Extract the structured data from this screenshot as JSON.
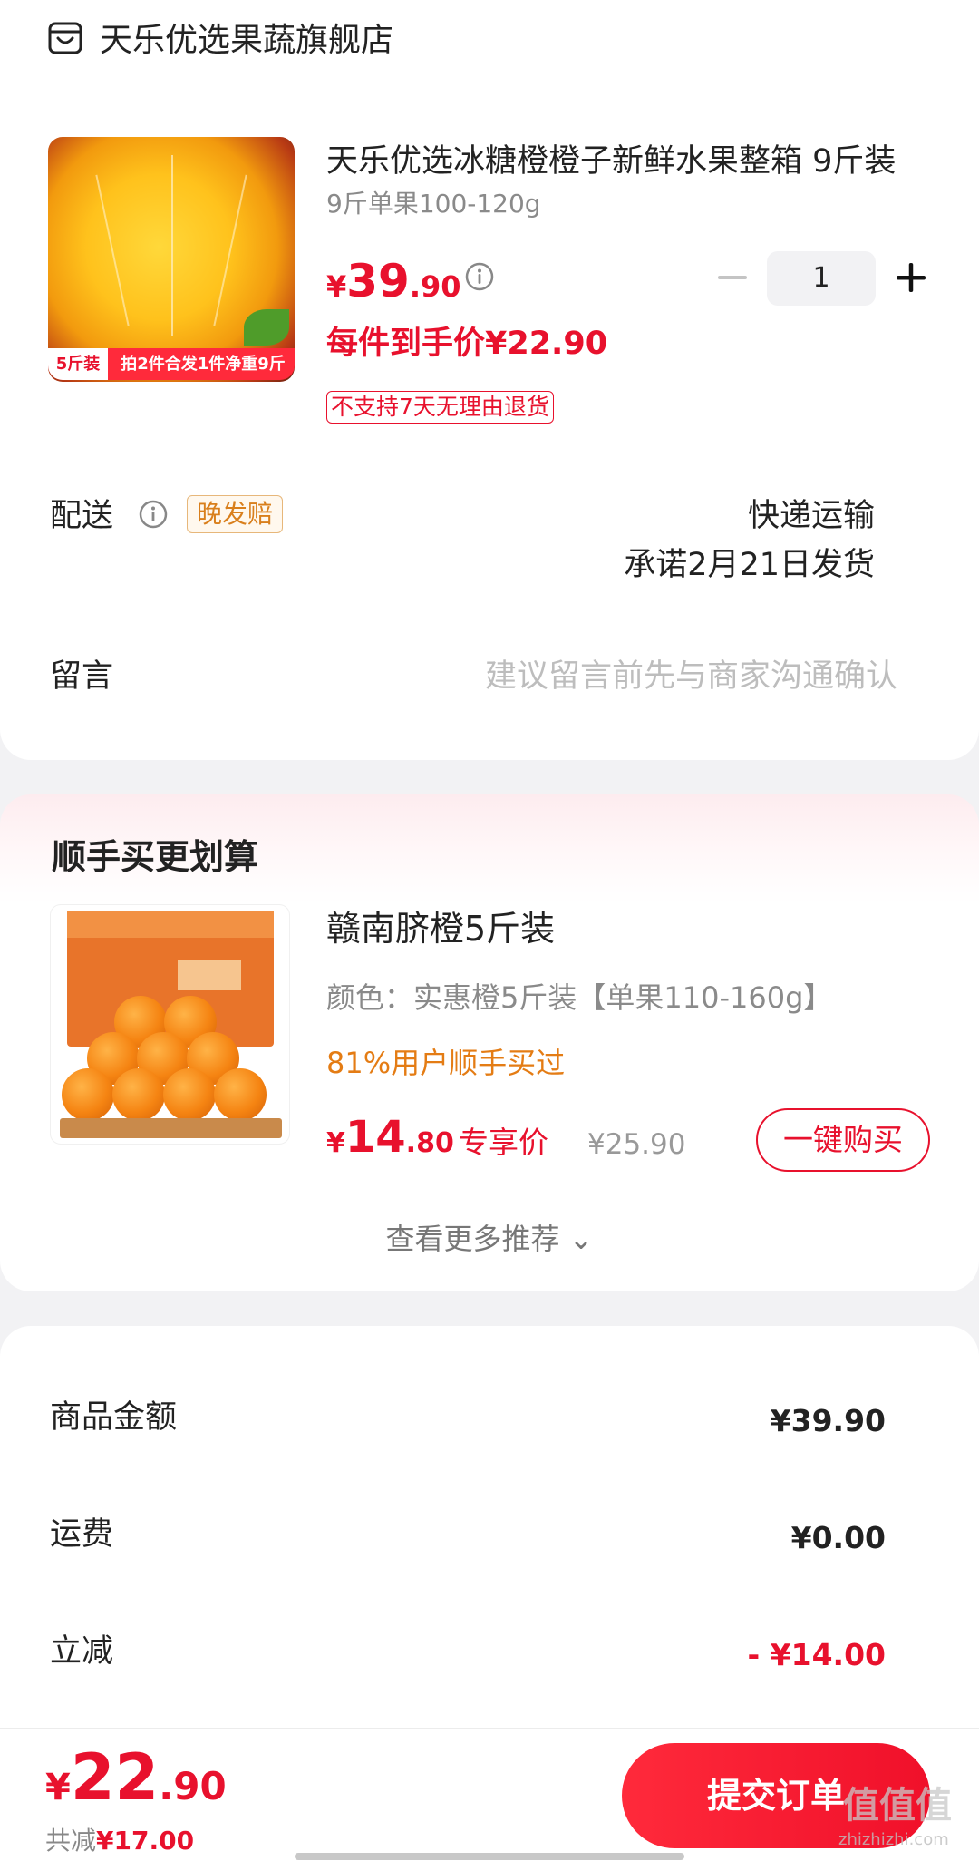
{
  "shop": {
    "name": "天乐优选果蔬旗舰店"
  },
  "product": {
    "title": "天乐优选冰糖橙橙子新鲜水果整箱 9斤装",
    "spec": "9斤单果100-120g",
    "price": {
      "symbol": "¥",
      "integer": "39",
      "decimal": ".90"
    },
    "quantity": "1",
    "per_item_price": "每件到手价¥22.90",
    "return_policy": "不支持7天无理由退货",
    "image_tag_left": "5斤装",
    "image_tag_right": "拍2件合发1件净重9斤"
  },
  "shipping": {
    "label": "配送",
    "badge": "晚发赔",
    "method": "快递运输",
    "promise": "承诺2月21日发货"
  },
  "message": {
    "label": "留言",
    "placeholder": "建议留言前先与商家沟通确认"
  },
  "recommend": {
    "title": "顺手买更划算",
    "item": {
      "name": "赣南脐橙5斤装",
      "spec": "颜色：实惠橙5斤装【单果110-160g】",
      "bought": "81%用户顺手买过",
      "price": {
        "symbol": "¥",
        "integer": "14",
        "decimal": ".80"
      },
      "exclusive_label": "专享价",
      "original_price": "¥25.90",
      "buy_button": "一键购买"
    },
    "more": "查看更多推荐 ⌄"
  },
  "summary": {
    "rows": [
      {
        "label": "商品金额",
        "value": "¥39.90"
      },
      {
        "label": "运费",
        "value": "¥0.00"
      },
      {
        "label": "立减",
        "value": "- ¥14.00"
      }
    ]
  },
  "checkout": {
    "total": {
      "symbol": "¥",
      "integer": "22",
      "decimal": ".90"
    },
    "saved_label": "共减",
    "saved_amount": "¥17.00",
    "submit": "提交订单"
  },
  "watermark": {
    "text": "值值值",
    "sub": "zhizhizhi.com"
  },
  "colors": {
    "accent": "#e8112d",
    "orange_text": "#e47c14",
    "badge_text": "#d97f1c"
  }
}
